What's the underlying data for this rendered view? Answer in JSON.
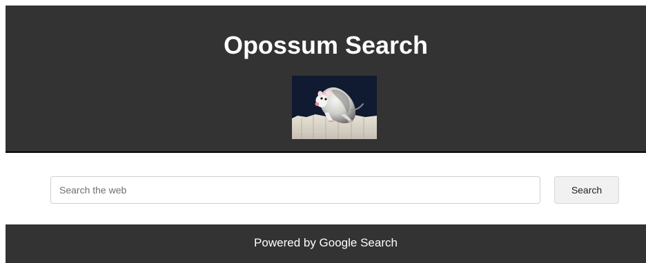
{
  "header": {
    "title": "Opossum Search",
    "image_icon": "opossum-photo"
  },
  "search": {
    "placeholder": "Search the web",
    "value": "",
    "button_label": "Search"
  },
  "footer": {
    "text": "Powered by Google Search"
  },
  "colors": {
    "header_background": "#333333",
    "footer_background": "#333333",
    "page_background": "#ffffff",
    "title_text": "#ffffff",
    "button_background": "#f1f1f1",
    "input_border": "#cfcfcf"
  }
}
